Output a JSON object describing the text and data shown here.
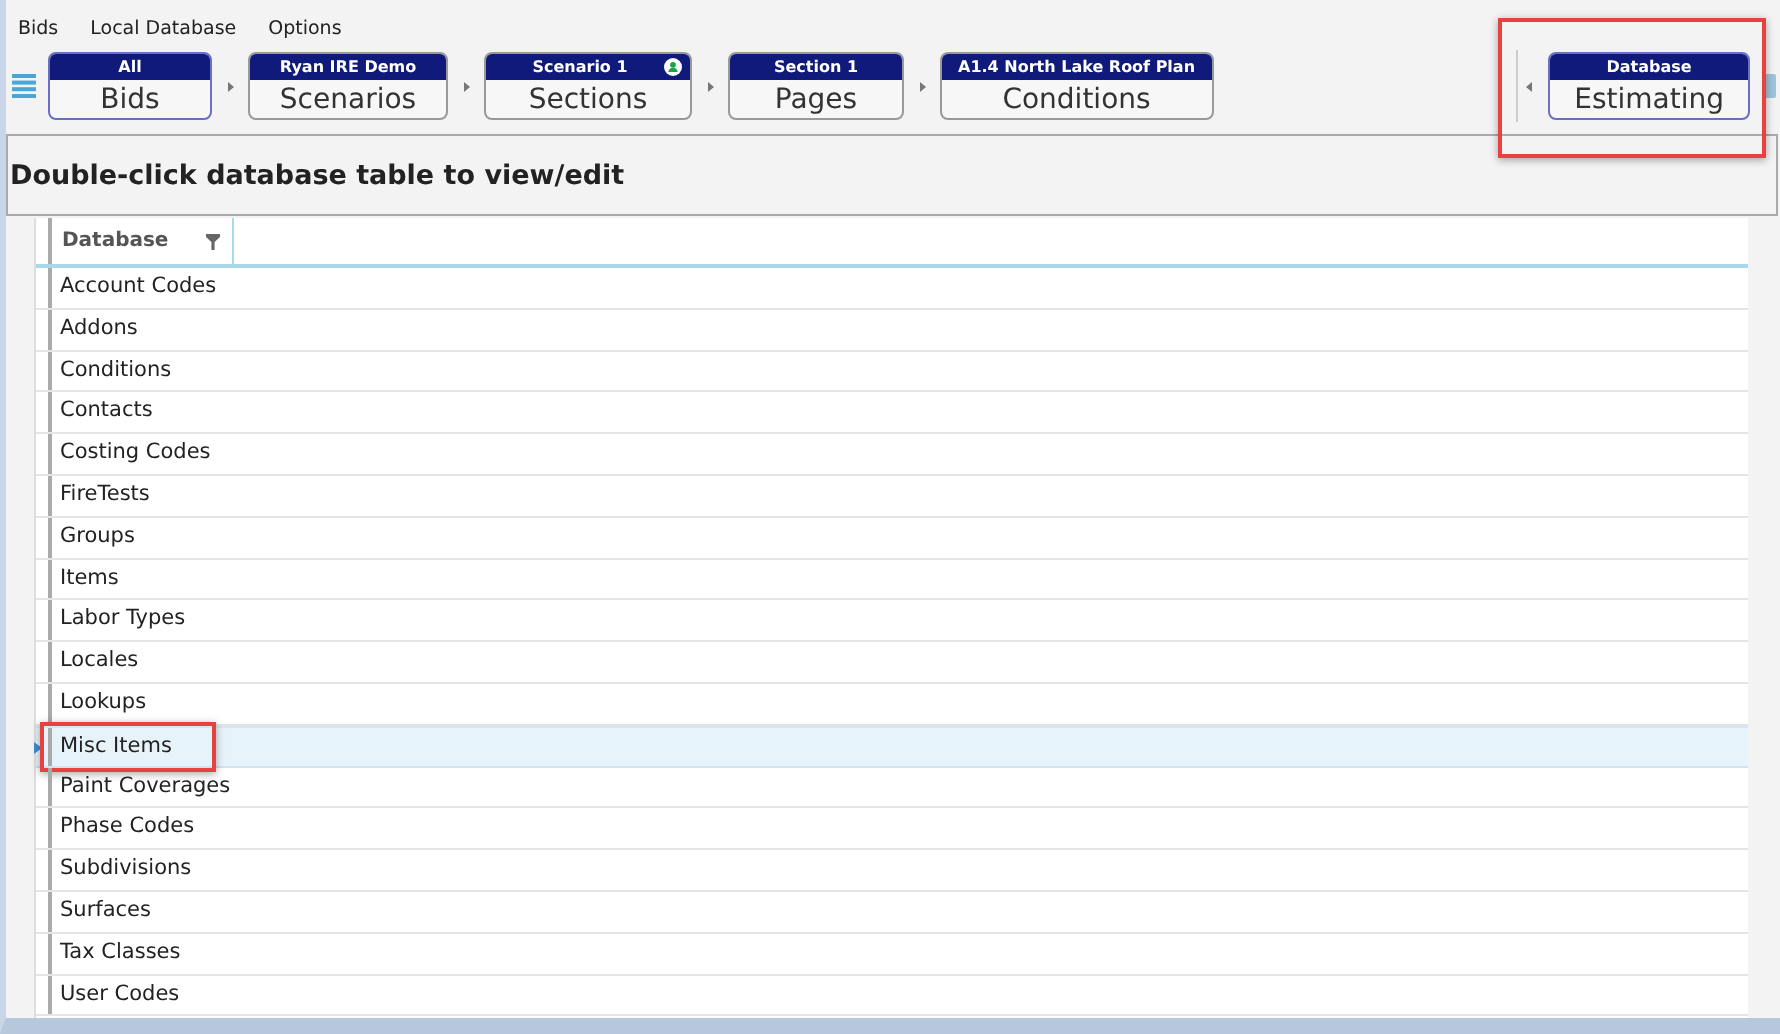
{
  "menu": [
    "Bids",
    "Local Database",
    "Options"
  ],
  "breadcrumbs": [
    {
      "header": "All",
      "label": "Bids",
      "selected": true,
      "user_badge": false
    },
    {
      "header": "Ryan IRE Demo",
      "label": "Scenarios",
      "selected": false,
      "user_badge": false
    },
    {
      "header": "Scenario 1",
      "label": "Sections",
      "selected": false,
      "user_badge": true
    },
    {
      "header": "Section 1",
      "label": "Pages",
      "selected": false,
      "user_badge": false
    },
    {
      "header": "A1.4 North Lake Roof Plan",
      "label": "Conditions",
      "selected": false,
      "user_badge": false
    }
  ],
  "module": {
    "header": "Database",
    "label": "Estimating",
    "selected": true,
    "highlighted": true
  },
  "instruction": "Double-click database table to view/edit",
  "table": {
    "columns": [
      "Database"
    ],
    "rows": [
      {
        "name": "Account Codes",
        "selected": false,
        "highlighted": false
      },
      {
        "name": "Addons",
        "selected": false,
        "highlighted": false
      },
      {
        "name": "Conditions",
        "selected": false,
        "highlighted": false
      },
      {
        "name": "Contacts",
        "selected": false,
        "highlighted": false
      },
      {
        "name": "Costing Codes",
        "selected": false,
        "highlighted": false
      },
      {
        "name": "FireTests",
        "selected": false,
        "highlighted": false
      },
      {
        "name": "Groups",
        "selected": false,
        "highlighted": false
      },
      {
        "name": "Items",
        "selected": false,
        "highlighted": false
      },
      {
        "name": "Labor Types",
        "selected": false,
        "highlighted": false
      },
      {
        "name": "Locales",
        "selected": false,
        "highlighted": false
      },
      {
        "name": "Lookups",
        "selected": false,
        "highlighted": false
      },
      {
        "name": "Misc Items",
        "selected": true,
        "highlighted": true
      },
      {
        "name": "Paint Coverages",
        "selected": false,
        "highlighted": false
      },
      {
        "name": "Phase Codes",
        "selected": false,
        "highlighted": false
      },
      {
        "name": "Subdivisions",
        "selected": false,
        "highlighted": false
      },
      {
        "name": "Surfaces",
        "selected": false,
        "highlighted": false
      },
      {
        "name": "Tax Classes",
        "selected": false,
        "highlighted": false
      },
      {
        "name": "User Codes",
        "selected": false,
        "highlighted": false
      }
    ]
  }
}
